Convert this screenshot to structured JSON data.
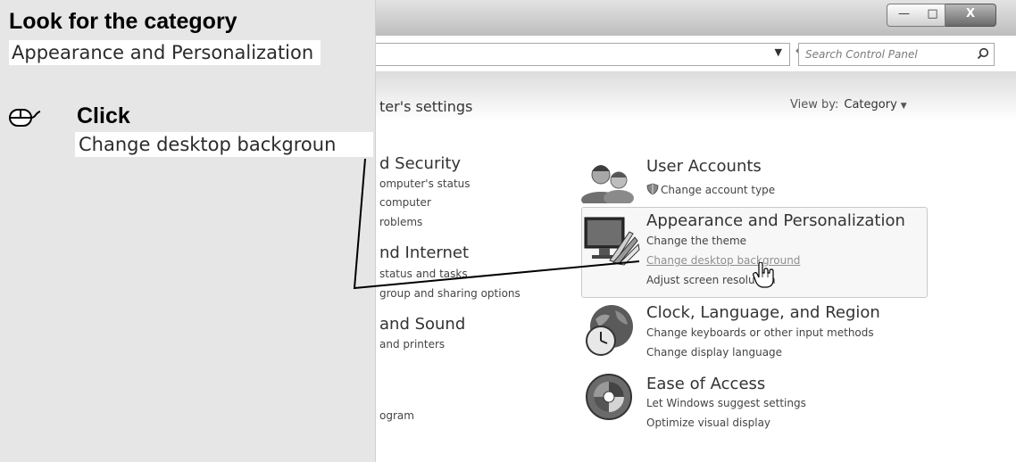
{
  "instruction": {
    "heading": "Look for the category",
    "category": "Appearance and Personalization",
    "action": "Click",
    "target": "Change desktop backgroun",
    "mouse_icon": "mouse-icon"
  },
  "window": {
    "search_placeholder": "Search Control Panel",
    "controls": {
      "minimize": "—",
      "maximize": "□",
      "close": "X"
    }
  },
  "control_panel": {
    "heading": "ter's settings",
    "view_by_label": "View by:",
    "view_by_value": "Category",
    "left_column": [
      {
        "title": "d Security",
        "links": [
          "omputer's status",
          "computer",
          "roblems"
        ]
      },
      {
        "title": "nd Internet",
        "links": [
          "status and tasks",
          "group and sharing options"
        ]
      },
      {
        "title": "and Sound",
        "links": [
          "and printers"
        ]
      },
      {
        "title": "",
        "links": [
          "ogram"
        ]
      }
    ],
    "categories": [
      {
        "title": "User Accounts",
        "links": [
          "Change account type"
        ],
        "icon": "users-icon"
      },
      {
        "title": "Appearance and Personalization",
        "links": [
          "Change the theme",
          "Change desktop background",
          "Adjust screen resolution"
        ],
        "icon": "appearance-icon"
      },
      {
        "title": "Clock, Language, and Region",
        "links": [
          "Change keyboards or other input methods",
          "Change display language"
        ],
        "icon": "globe-clock-icon"
      },
      {
        "title": "Ease of Access",
        "links": [
          "Let Windows suggest settings",
          "Optimize visual display"
        ],
        "icon": "ease-of-access-icon"
      }
    ]
  }
}
